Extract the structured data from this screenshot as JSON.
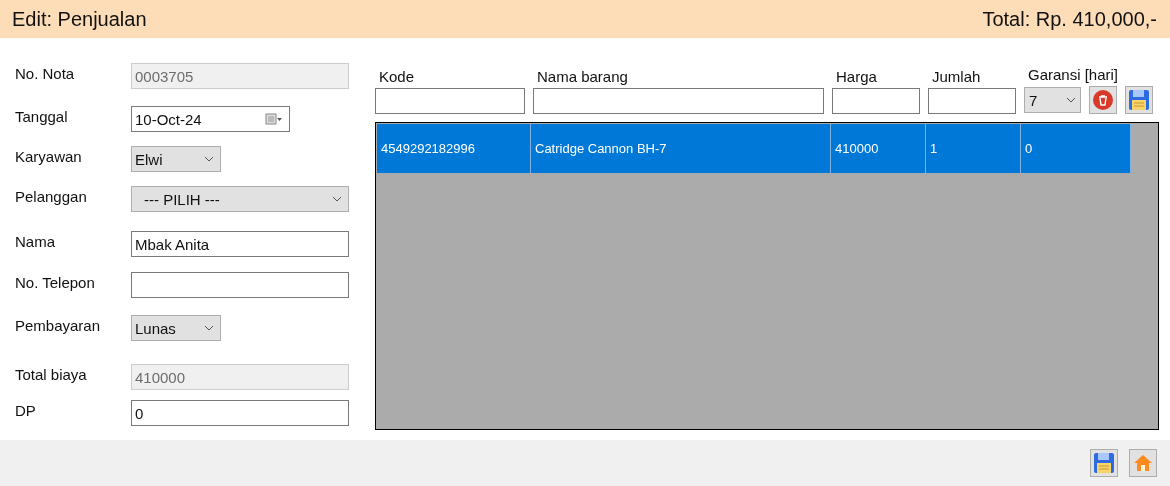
{
  "header": {
    "title": "Edit: Penjualan",
    "total": "Total: Rp. 410,000,-"
  },
  "form": [
    {
      "label": "No. Nota",
      "kind": "text",
      "value": "0003705",
      "disabled": true
    },
    {
      "label": "Tanggal",
      "kind": "date",
      "value": "10-Oct-24"
    },
    {
      "label": "Karyawan",
      "kind": "select",
      "value": "Elwi"
    },
    {
      "label": "Pelanggan",
      "kind": "combo",
      "value": "--- PILIH ---"
    },
    {
      "label": "Nama",
      "kind": "text",
      "value": "Mbak Anita",
      "disabled": false
    },
    {
      "label": "No. Telepon",
      "kind": "text",
      "disabled": false
    },
    {
      "label": "Pembayaran",
      "kind": "select",
      "value": "Lunas"
    },
    {
      "label": "Total biaya",
      "kind": "text",
      "value": "410000",
      "disabled": true
    },
    {
      "label": "DP",
      "kind": "text",
      "value": "0",
      "disabled": false
    }
  ],
  "entry": {
    "columns": [
      {
        "label": "Kode",
        "kind": "text"
      },
      {
        "label": "Nama barang",
        "kind": "text"
      },
      {
        "label": "Harga",
        "kind": "text"
      },
      {
        "label": "Jumlah",
        "kind": "text"
      },
      {
        "label": "Garansi [hari]",
        "kind": "select",
        "value": "7"
      }
    ]
  },
  "table": {
    "rows": [
      {
        "selected": true,
        "cells": [
          "4549292182996",
          "Catridge Cannon BH-7",
          "410000",
          "1",
          "0"
        ]
      }
    ]
  }
}
